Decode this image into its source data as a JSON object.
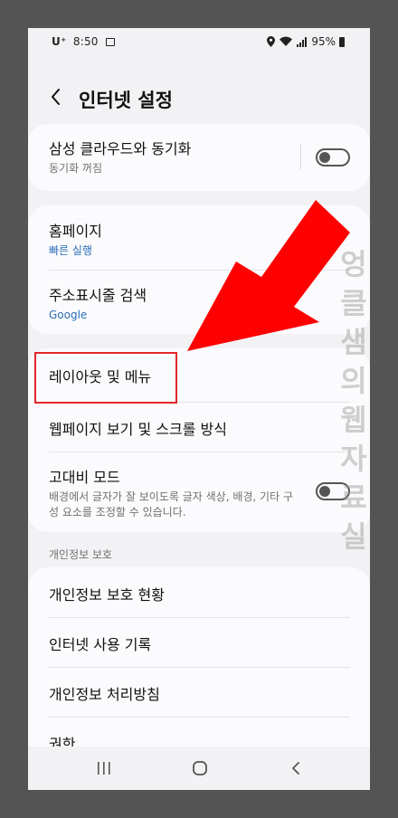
{
  "status_bar": {
    "carrier": "U⁺",
    "time": "8:50",
    "battery": "95%"
  },
  "header": {
    "title": "인터넷 설정"
  },
  "sync": {
    "label": "삼성 클라우드와 동기화",
    "status": "동기화 꺼짐",
    "enabled": false
  },
  "home_group": [
    {
      "label": "홈페이지",
      "value": "빠른 실행"
    },
    {
      "label": "주소표시줄 검색",
      "value": "Google"
    }
  ],
  "layout_group": {
    "layout_menu": "레이아웃 및 메뉴",
    "scroll": "웹페이지 보기 및 스크롤 방식",
    "high_contrast": {
      "label": "고대비 모드",
      "desc": "배경에서 글자가 잘 보이도록 글자 색상, 배경, 기타 구성 요소를 조정할 수 있습니다.",
      "enabled": false
    }
  },
  "privacy": {
    "section_label": "개인정보 보호",
    "items": [
      "개인정보 보호 현황",
      "인터넷 사용 기록",
      "개인정보 처리방침",
      "권한"
    ]
  },
  "watermark": "엉클샘의웹자료실",
  "colors": {
    "highlight": "#e3262a",
    "arrow": "#ff0000",
    "link_blue": "#2a6db6"
  },
  "navbar": {
    "icons": [
      "recents-icon",
      "home-icon",
      "back-icon"
    ]
  }
}
